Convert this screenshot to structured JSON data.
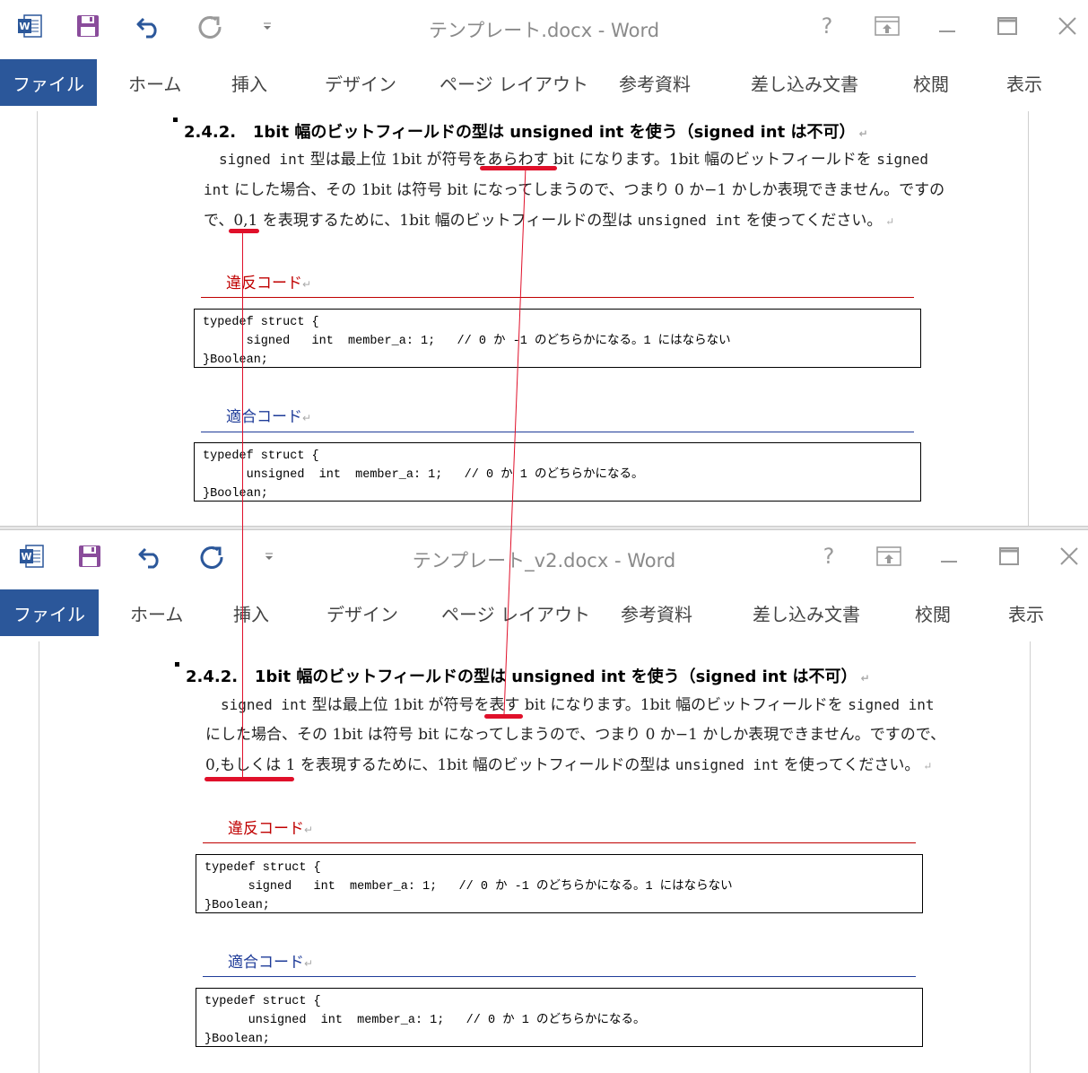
{
  "window1": {
    "title": "テンプレート.docx - Word",
    "ribbon_tabs": [
      "ファイル",
      "ホーム",
      "挿入",
      "デザイン",
      "ページ レイアウト",
      "参考資料",
      "差し込み文書",
      "校閲",
      "表示"
    ],
    "heading": "2.4.2.   1bit 幅のビットフィールドの型は unsigned int を使う（signed int は不可）",
    "para_lines": [
      [
        "signed int",
        " 型は最上位 1bit が符号をあらわす bit になります。1bit 幅のビットフィールドを ",
        "signed"
      ],
      [
        "int",
        " にした場合、その 1bit は符号 bit になってしまうので、つまり 0 か−1 かしか表現できません。ですの"
      ],
      [
        "で、0,1 を表現するために、1bit 幅のビットフィールドの型は ",
        "unsigned int",
        " を使ってください。"
      ]
    ],
    "bad_label": "違反コード",
    "bad_code": [
      "typedef struct {",
      "      signed   int  member_a: 1;   // 0 か -1 のどちらかになる。1 にはならない",
      "}Boolean;"
    ],
    "good_label": "適合コード",
    "good_code": [
      "typedef struct {",
      "      unsigned  int  member_a: 1;   // 0 か 1 のどちらかになる。",
      "}Boolean;"
    ]
  },
  "window2": {
    "title": "テンプレート_v2.docx - Word",
    "ribbon_tabs": [
      "ファイル",
      "ホーム",
      "挿入",
      "デザイン",
      "ページ レイアウト",
      "参考資料",
      "差し込み文書",
      "校閲",
      "表示"
    ],
    "heading": "2.4.2.   1bit 幅のビットフィールドの型は unsigned int を使う（signed int は不可）",
    "para_lines": [
      [
        "signed int",
        " 型は最上位 1bit が符号を表す bit になります。1bit 幅のビットフィールドを ",
        "signed int"
      ],
      [
        "にした場合、その 1bit は符号 bit になってしまうので、つまり 0 か−1 かしか表現できません。ですので、"
      ],
      [
        "0,もしくは 1 を表現するために、1bit 幅のビットフィールドの型は ",
        "unsigned int",
        " を使ってください。"
      ]
    ],
    "bad_label": "違反コード",
    "bad_code": [
      "typedef struct {",
      "      signed   int  member_a: 1;   // 0 か -1 のどちらかになる。1 にはならない",
      "}Boolean;"
    ],
    "good_label": "適合コード",
    "good_code": [
      "typedef struct {",
      "      unsigned  int  member_a: 1;   // 0 か 1 のどちらかになる。",
      "}Boolean;"
    ]
  },
  "colors": {
    "file_tab": "#2b579a",
    "annotation_red": "#e0102a",
    "violation_red": "#c00000",
    "compliant_blue": "#1f3c99"
  },
  "icons": [
    "word-icon",
    "save-icon",
    "undo-icon",
    "redo-icon",
    "customize-qat-icon",
    "help-icon",
    "ribbon-display-icon",
    "minimize-icon",
    "maximize-icon",
    "close-icon"
  ]
}
